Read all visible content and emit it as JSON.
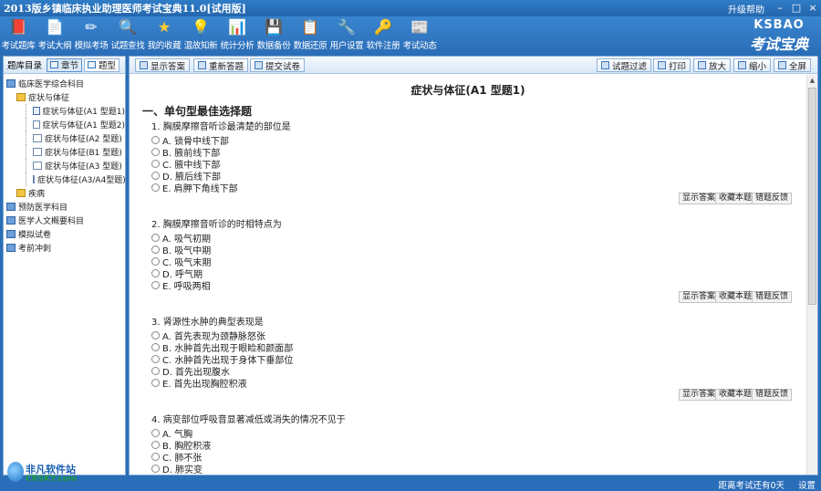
{
  "app": {
    "title": "2013版乡镇临床执业助理医师考试宝典11.0[试用版]",
    "help_label": "升级帮助",
    "minimize": "–",
    "maximize": "□",
    "close": "×"
  },
  "toolbar": {
    "items": [
      {
        "label": "考试题库",
        "icon": "question-bank-icon",
        "glyph": "📕"
      },
      {
        "label": "考试大纲",
        "icon": "syllabus-icon",
        "glyph": "📄"
      },
      {
        "label": "模拟考场",
        "icon": "mock-exam-icon",
        "glyph": "✏"
      },
      {
        "label": "试题查找",
        "icon": "search-icon",
        "glyph": "🔍"
      },
      {
        "label": "我的收藏",
        "icon": "star-icon",
        "glyph": "★"
      },
      {
        "label": "温故知新",
        "icon": "lightbulb-icon",
        "glyph": "💡"
      },
      {
        "label": "统计分析",
        "icon": "statistics-icon",
        "glyph": "📊"
      },
      {
        "label": "数据备份",
        "icon": "backup-icon",
        "glyph": "💾"
      },
      {
        "label": "数据还原",
        "icon": "restore-icon",
        "glyph": "📋"
      },
      {
        "label": "用户设置",
        "icon": "settings-icon",
        "glyph": "🔧"
      },
      {
        "label": "软件注册",
        "icon": "register-icon",
        "glyph": "🔑"
      },
      {
        "label": "考试动态",
        "icon": "news-icon",
        "glyph": "📰"
      }
    ],
    "logo_en": "KSBAO",
    "logo_cn": "考试宝典"
  },
  "left": {
    "header_label": "题库目录",
    "tab_chapter": "章节",
    "tab_type": "题型",
    "tree": [
      {
        "label": "临床医学综合科目",
        "level": 0,
        "icon": "book"
      },
      {
        "label": "症状与体征",
        "level": 1,
        "icon": "fold"
      },
      {
        "label": "症状与体征(A1 型题1)",
        "level": 2,
        "icon": "docsel"
      },
      {
        "label": "症状与体征(A1 型题2)",
        "level": 2,
        "icon": "doc"
      },
      {
        "label": "症状与体征(A2 型题)",
        "level": 2,
        "icon": "doc"
      },
      {
        "label": "症状与体征(B1 型题)",
        "level": 2,
        "icon": "doc"
      },
      {
        "label": "症状与体征(A3 型题)",
        "level": 2,
        "icon": "doc"
      },
      {
        "label": "症状与体征(A3/A4型题)",
        "level": 2,
        "icon": "doc"
      },
      {
        "label": "疾病",
        "level": 1,
        "icon": "fold"
      },
      {
        "label": "预防医学科目",
        "level": 0,
        "icon": "book"
      },
      {
        "label": "医学人文概要科目",
        "level": 0,
        "icon": "book"
      },
      {
        "label": "模拟试卷",
        "level": 0,
        "icon": "book"
      },
      {
        "label": "考前冲刺",
        "level": 0,
        "icon": "book"
      }
    ]
  },
  "right_toolbar": {
    "show_answer": "显示答案",
    "restart": "重新答题",
    "submit": "提交试卷",
    "filter": "试题过滤",
    "print": "打印",
    "zoom_in": "放大",
    "zoom_out": "缩小",
    "fullscreen": "全屏"
  },
  "paper": {
    "title": "症状与体征(A1 型题1)",
    "section": "一、单句型最佳选择题",
    "actions": {
      "show": "显示答案",
      "fav": "收藏本题",
      "report": "错题反馈"
    },
    "questions": [
      {
        "text": "1. 胸膜摩擦音听诊最清楚的部位是",
        "options": [
          "A. 锁骨中线下部",
          "B. 腋前线下部",
          "C. 腋中线下部",
          "D. 腋后线下部",
          "E. 肩胛下角线下部"
        ]
      },
      {
        "text": "2. 胸膜摩擦音听诊的时相特点为",
        "options": [
          "A. 吸气初期",
          "B. 吸气中期",
          "C. 吸气末期",
          "D. 呼气期",
          "E. 呼吸两相"
        ]
      },
      {
        "text": "3. 肾源性水肿的典型表现是",
        "options": [
          "A. 首先表现为颈静脉怒张",
          "B. 水肿首先出现于眼睑和颜面部",
          "C. 水肿首先出现于身体下垂部位",
          "D. 首先出现腹水",
          "E. 首先出现胸腔积液"
        ]
      },
      {
        "text": "4. 病变部位呼吸音显著减低或消失的情况不见于",
        "options": [
          "A. 气胸",
          "B. 胸腔积液",
          "C. 肺不张",
          "D. 肺实变"
        ]
      }
    ]
  },
  "status": {
    "exam_text": "距离考试还有0天",
    "settings": "设置"
  },
  "watermark": {
    "title": "非凡软件站",
    "url": "CRSKY.com"
  }
}
